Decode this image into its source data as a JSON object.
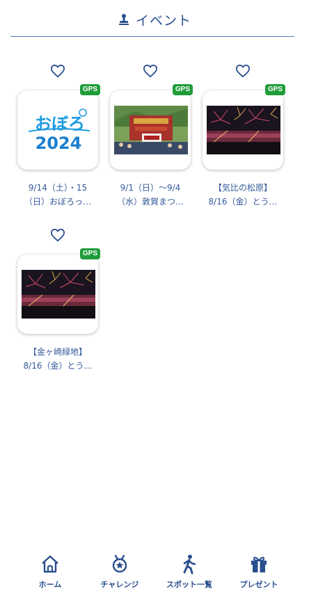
{
  "header": {
    "title": "イベント",
    "icon": "stamp-icon"
  },
  "colors": {
    "primary": "#2a4f8f",
    "gps_badge": "#1f9c3a",
    "divider": "#4a7ac0"
  },
  "events": [
    {
      "badge": "GPS",
      "favorite_icon": "heart-outline-icon",
      "image": "obororo-2024-logo",
      "logo_text": "おぼろ",
      "logo_year": "2024",
      "caption_line1": "9/14（土）・15",
      "caption_line2": "（日）おぼろっ…"
    },
    {
      "badge": "GPS",
      "favorite_icon": "heart-outline-icon",
      "image": "festival-float-photo",
      "caption_line1": "9/1（日）～9/4",
      "caption_line2": "（水）敦賀まつ…"
    },
    {
      "badge": "GPS",
      "favorite_icon": "heart-outline-icon",
      "image": "fireworks-photo",
      "caption_line1": "【気比の松原】",
      "caption_line2": "8/16（金）とう…"
    },
    {
      "badge": "GPS",
      "favorite_icon": "heart-outline-icon",
      "image": "fireworks-photo",
      "caption_line1": "【金ヶ崎緑地】",
      "caption_line2": "8/16（金）とう…"
    }
  ],
  "bottom_nav": [
    {
      "label": "ホーム",
      "icon": "home-icon"
    },
    {
      "label": "チャレンジ",
      "icon": "medal-icon"
    },
    {
      "label": "スポット一覧",
      "icon": "walking-person-icon"
    },
    {
      "label": "プレゼント",
      "icon": "gift-icon"
    }
  ]
}
